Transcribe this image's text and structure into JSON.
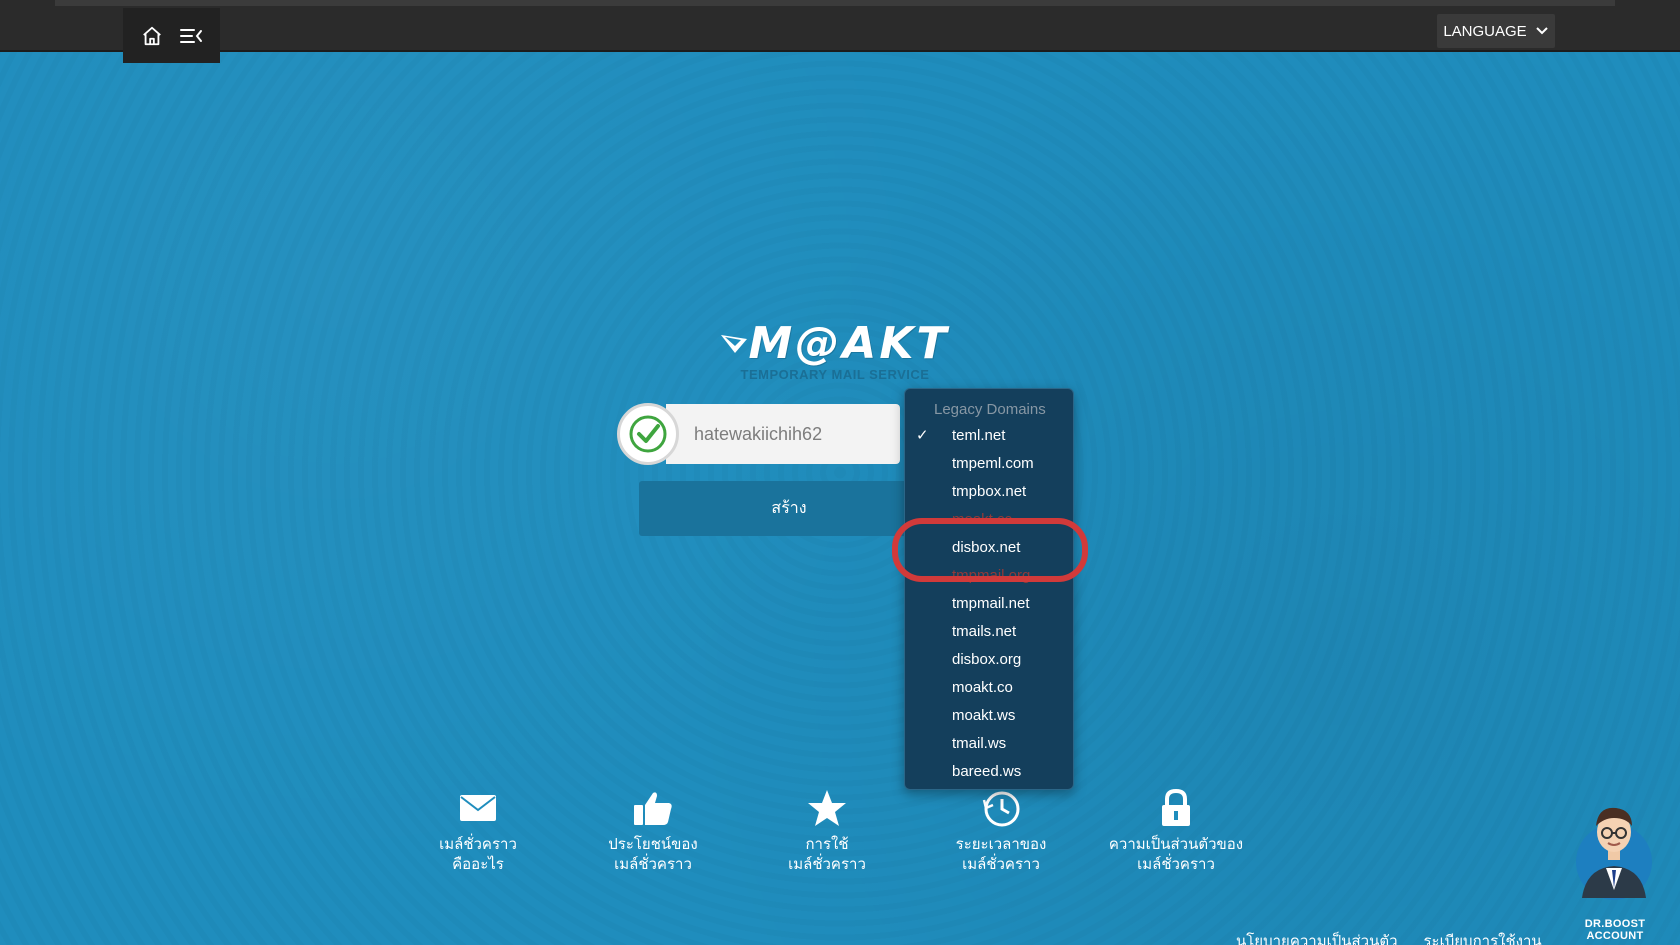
{
  "topbar": {
    "language_label": "LANGUAGE"
  },
  "logo": {
    "title": "M@AKT",
    "subtitle": "TEMPORARY MAIL SERVICE"
  },
  "form": {
    "email_value": "hatewakiichih62",
    "create_label": "สร้าง"
  },
  "dropdown": {
    "header": "Legacy Domains",
    "selected": "teml.net",
    "items": [
      {
        "label": "teml.net",
        "checked": true,
        "disabled": false
      },
      {
        "label": "tmpeml.com",
        "checked": false,
        "disabled": false
      },
      {
        "label": "tmpbox.net",
        "checked": false,
        "disabled": false
      },
      {
        "label": "moakt.cc",
        "checked": false,
        "disabled": true
      },
      {
        "label": "disbox.net",
        "checked": false,
        "disabled": false
      },
      {
        "label": "tmpmail.org",
        "checked": false,
        "disabled": true
      },
      {
        "label": "tmpmail.net",
        "checked": false,
        "disabled": false
      },
      {
        "label": "tmails.net",
        "checked": false,
        "disabled": false
      },
      {
        "label": "disbox.org",
        "checked": false,
        "disabled": false
      },
      {
        "label": "moakt.co",
        "checked": false,
        "disabled": false
      },
      {
        "label": "moakt.ws",
        "checked": false,
        "disabled": false
      },
      {
        "label": "tmail.ws",
        "checked": false,
        "disabled": false
      },
      {
        "label": "bareed.ws",
        "checked": false,
        "disabled": false
      }
    ]
  },
  "features": [
    {
      "label": "เมล์ชั่วคราว\nคืออะไร",
      "icon": "envelope-icon"
    },
    {
      "label": "ประโยชน์ของ\nเมล์ชั่วคราว",
      "icon": "thumbs-up-icon"
    },
    {
      "label": "การใช้\nเมล์ชั่วคราว",
      "icon": "star-icon"
    },
    {
      "label": "ระยะเวลาของ\nเมล์ชั่วคราว",
      "icon": "clock-icon"
    },
    {
      "label": "ความเป็นส่วนตัวของ\nเมล์ชั่วคราว",
      "icon": "lock-icon"
    }
  ],
  "footer": {
    "privacy": "นโยบายความเป็นส่วนตัว",
    "terms": "ระเบียบการใช้งาน"
  },
  "avatar": {
    "label": "DR.BOOST ACCOUNT"
  },
  "colors": {
    "background": "#1f8dbd",
    "topbar": "#2b2b2b",
    "dropdown": "#143f5c",
    "highlight": "#d13a3a",
    "check_green": "#3fa53f"
  }
}
